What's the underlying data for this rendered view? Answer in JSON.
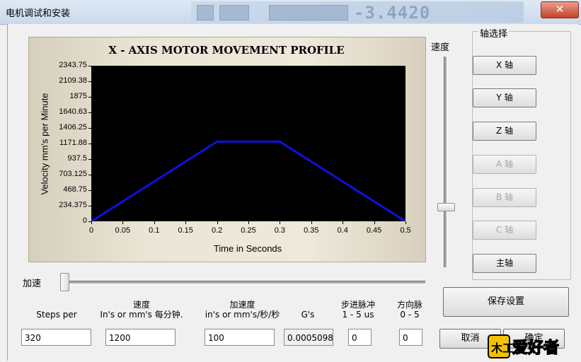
{
  "window": {
    "title": "电机调试和安装",
    "close_glyph": "✕",
    "background_digits": "-3.4420"
  },
  "chart": {
    "title": "X - AXIS MOTOR MOVEMENT PROFILE",
    "y_ticks": [
      "2343.75",
      "2109.38",
      "1875",
      "1640.63",
      "1406.25",
      "1171.88",
      "937.5",
      "703.125",
      "468.75",
      "234.375",
      "0"
    ],
    "x_ticks": [
      "0",
      "0.05",
      "0.1",
      "0.15",
      "0.2",
      "0.25",
      "0.3",
      "0.35",
      "0.4",
      "0.45",
      "0.5"
    ]
  },
  "chart_data": {
    "type": "line",
    "title": "X - AXIS MOTOR MOVEMENT PROFILE",
    "xlabel": "Time in Seconds",
    "ylabel": "Velocity mm's per Minute",
    "xlim": [
      0,
      0.5
    ],
    "ylim": [
      0,
      2343.75
    ],
    "series": [
      {
        "x": [
          0,
          0.2,
          0.3,
          0.5
        ],
        "values": [
          0,
          1200,
          1200,
          0
        ],
        "color": "#1010e0"
      }
    ],
    "background": "#000000"
  },
  "speed_slider": {
    "label": "速度",
    "value": 0.71
  },
  "accel_slider": {
    "label": "加速",
    "value": 0.01
  },
  "axis_select": {
    "title": "轴选择",
    "buttons": [
      {
        "label": "X 轴",
        "enabled": true
      },
      {
        "label": "Y 轴",
        "enabled": true
      },
      {
        "label": "Z 轴",
        "enabled": true
      },
      {
        "label": "A 轴",
        "enabled": false
      },
      {
        "label": "B 轴",
        "enabled": false
      },
      {
        "label": "C 轴",
        "enabled": false
      },
      {
        "label": "主轴",
        "enabled": true
      }
    ]
  },
  "fields": {
    "steps_per": {
      "label": "Steps per",
      "value": "320"
    },
    "velocity": {
      "label1": "速度",
      "label2": "In's or mm's 每分钟.",
      "value": "1200"
    },
    "acceleration": {
      "label1": "加速度",
      "label2": "in's or mm's/秒/秒",
      "value": "100"
    },
    "g": {
      "label": "G's",
      "value": "0.0005098"
    },
    "step_pulse": {
      "label1": "步进脉冲",
      "label2": "1 - 5 us",
      "value": "0"
    },
    "dir_pulse": {
      "label1": "方向脉",
      "label2": "0 - 5",
      "value": "0"
    }
  },
  "buttons": {
    "save": "保存设置",
    "cancel": "取消",
    "ok": "确定"
  },
  "watermark": {
    "text": "爱好者",
    "logo_char": "木工"
  }
}
